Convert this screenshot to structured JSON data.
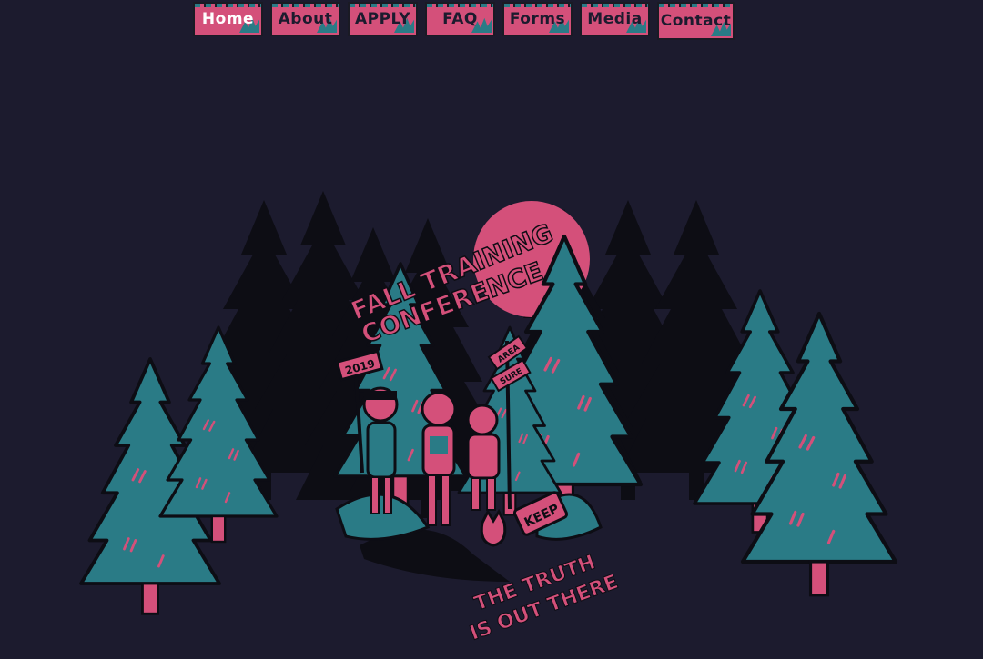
{
  "nav": {
    "items": [
      {
        "label": "Home",
        "active": true
      },
      {
        "label": "About"
      },
      {
        "label": "APPLY"
      },
      {
        "label": "FAQ"
      },
      {
        "label": "Forms"
      },
      {
        "label": "Media"
      },
      {
        "label": "Contact"
      }
    ]
  },
  "hero": {
    "title_line1": "FALL TRAINING",
    "title_line2": "CONFERENCE",
    "year_sign": "2019",
    "sign_1": "AREA",
    "sign_2": "SURE",
    "keep_sign": "KEEP",
    "tagline_line1": "THE TRUTH",
    "tagline_line2": "IS OUT THERE"
  },
  "colors": {
    "background": "#1c1b2e",
    "pink": "#d4507a",
    "teal": "#2a7b86",
    "ink": "#0d0d14"
  }
}
